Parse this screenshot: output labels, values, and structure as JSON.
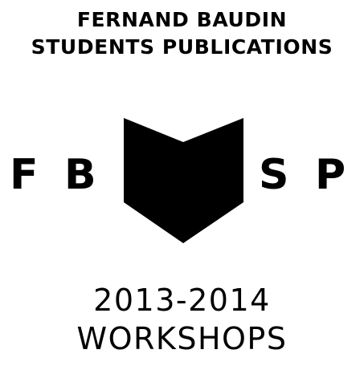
{
  "header": {
    "line1": "FERNAND BAUDIN",
    "line2": "STUDENTS PUBLICATIONS"
  },
  "logo": {
    "letters": [
      "F",
      "B",
      "S",
      "P"
    ],
    "icon": "open-book-icon",
    "color": "#000000"
  },
  "footer": {
    "years": "2013-2014",
    "label": "WORKSHOPS"
  }
}
